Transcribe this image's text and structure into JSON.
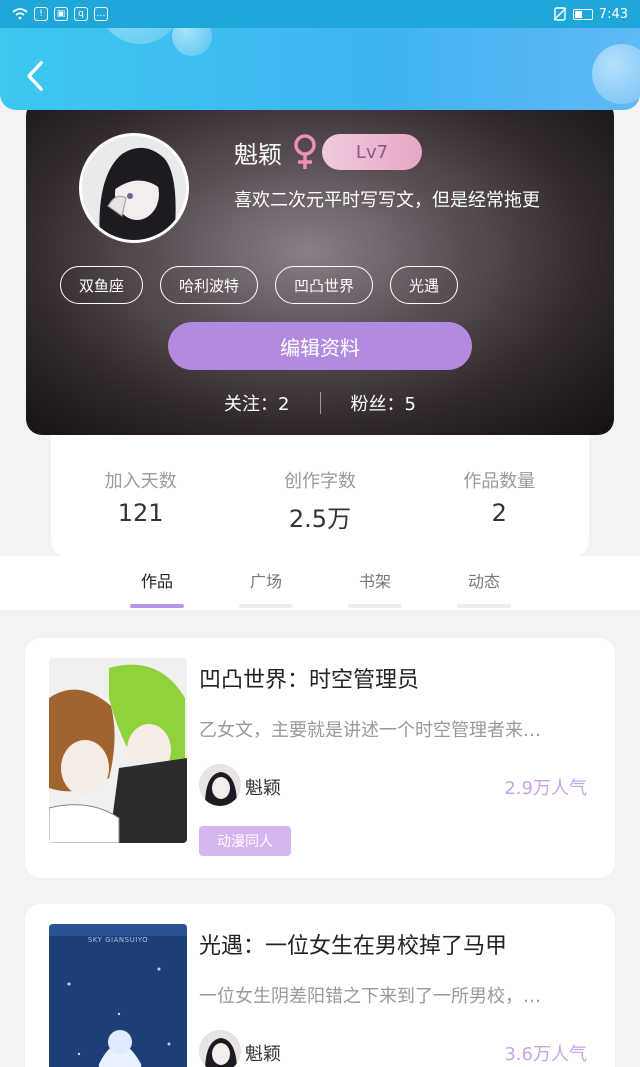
{
  "status_bar": {
    "time": "7:43"
  },
  "profile": {
    "username": "魁颖",
    "level": "Lv7",
    "bio": "喜欢二次元平时写写文，但是经常拖更",
    "tags": [
      "双鱼座",
      "哈利波特",
      "凹凸世界",
      "光遇"
    ],
    "edit_button": "编辑资料",
    "following_label": "关注：",
    "following_count": "2",
    "followers_label": "粉丝：",
    "followers_count": "5"
  },
  "stats": [
    {
      "label": "加入天数",
      "value": "121"
    },
    {
      "label": "创作字数",
      "value": "2.5万"
    },
    {
      "label": "作品数量",
      "value": "2"
    }
  ],
  "tabs": [
    "作品",
    "广场",
    "书架",
    "动态"
  ],
  "works": [
    {
      "title": "凹凸世界：时空管理员",
      "description": "乙女文，主要就是讲述一个时空管理者来…",
      "author": "魁颖",
      "popularity": "2.9万人气",
      "tag": "动漫同人"
    },
    {
      "title": "光遇：一位女生在男校掉了马甲",
      "description": "一位女生阴差阳错之下来到了一所男校，…",
      "author": "魁颖",
      "popularity": "3.6万人气",
      "cover_text": "SKY GIANSUIYO"
    }
  ],
  "colors": {
    "header": "#3cc8ef",
    "accent_purple": "#b28be0",
    "popularity": "#c7a4e6"
  }
}
